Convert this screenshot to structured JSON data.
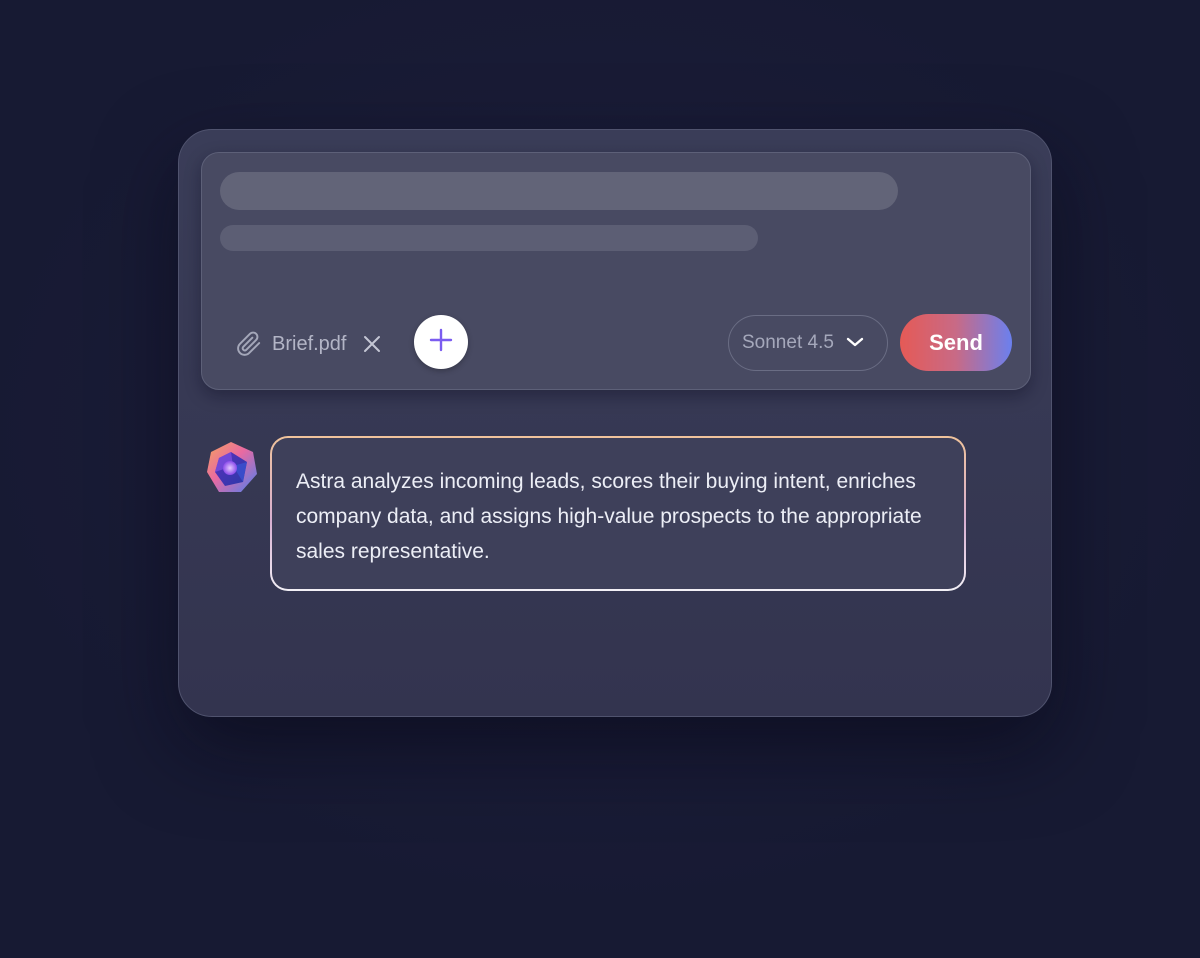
{
  "composer": {
    "attachment": {
      "file_name": "Brief.pdf",
      "icon": "paperclip-icon",
      "remove_icon": "close-icon"
    },
    "add_icon": "plus-icon",
    "model_select": {
      "selected": "Sonnet 4.5",
      "icon": "chevron-down-icon"
    },
    "send_label": "Send"
  },
  "message": {
    "avatar_icon": "gem-logo-icon",
    "text": "Astra analyzes incoming leads, scores their buying intent, enriches company data, and assigns high-value prospects to the appropriate sales representative."
  },
  "colors": {
    "background": "#171a33",
    "card": "#373a55",
    "composer": "#484a62",
    "send_gradient_start": "#e55a56",
    "send_gradient_end": "#6b80ee",
    "plus_accent": "#7b5cf0"
  }
}
